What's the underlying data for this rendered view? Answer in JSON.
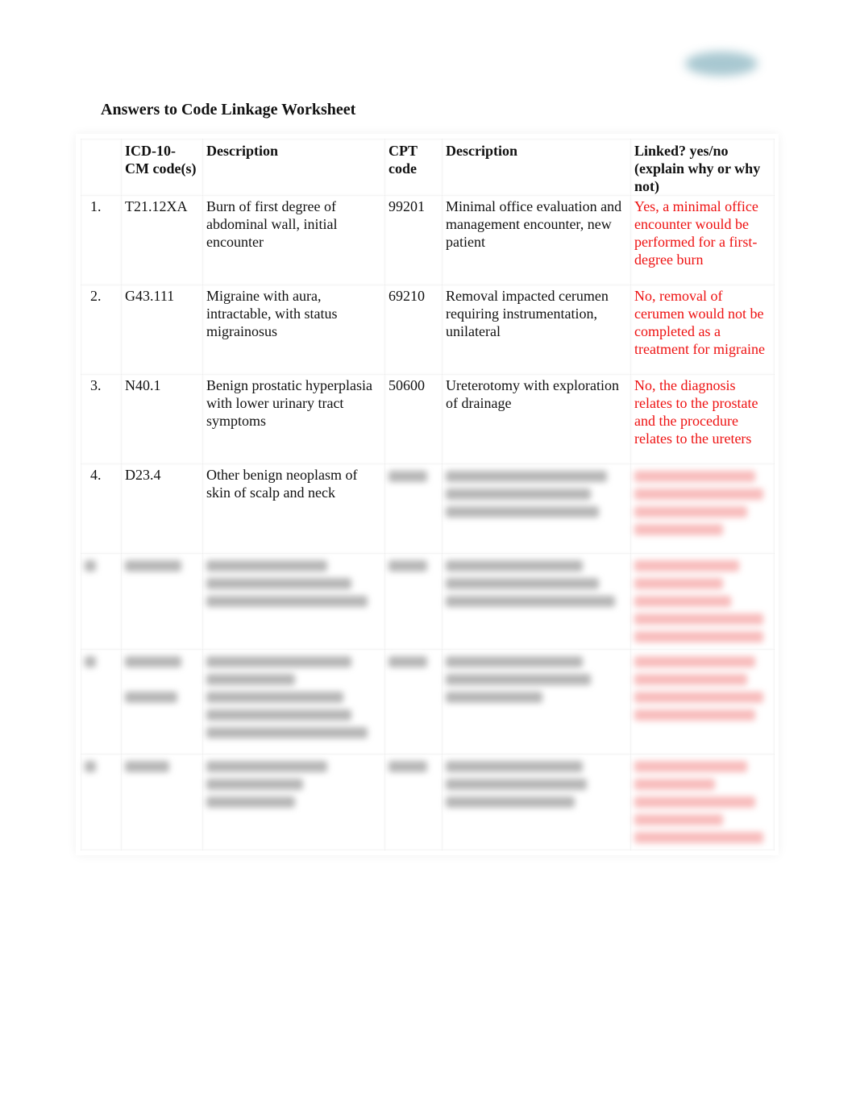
{
  "document": {
    "title": "Answers to Code Linkage Worksheet",
    "logo_icon": "publisher-logo-blurred"
  },
  "table": {
    "headers": {
      "num": "",
      "icd": "ICD-10-CM code(s)",
      "desc1": "Description",
      "cpt": "CPT code",
      "desc2": "Description",
      "linked": "Linked? yes/no (explain why or why not)"
    },
    "rows": [
      {
        "num": "1.",
        "icd": "T21.12XA",
        "desc1": "Burn of first degree of abdominal wall, initial encounter",
        "cpt": "99201",
        "desc2": "Minimal office evaluation and management encounter, new patient",
        "linked": "Yes, a minimal office encounter would be performed for a first-degree burn"
      },
      {
        "num": "2.",
        "icd": "G43.111",
        "desc1": "Migraine with aura, intractable, with status migrainosus",
        "cpt": "69210",
        "desc2": "Removal impacted cerumen requiring instrumentation, unilateral",
        "linked": "No, removal of cerumen would not be completed as a treatment for migraine"
      },
      {
        "num": "3.",
        "icd": "N40.1",
        "desc1": "Benign prostatic hyperplasia with lower urinary tract symptoms",
        "cpt": "50600",
        "desc2": "Ureterotomy with exploration of drainage",
        "linked": "No, the diagnosis relates to the prostate and the procedure relates to the ureters"
      },
      {
        "num": "4.",
        "icd": "D23.4",
        "desc1": "Other benign neoplasm of skin of scalp and neck",
        "cpt": "",
        "desc2": "",
        "linked": ""
      }
    ],
    "blurred_rows_count": 3
  },
  "colors": {
    "answer_text": "#ee1111",
    "body_text": "#111111",
    "logo": "#9fc2cc"
  }
}
